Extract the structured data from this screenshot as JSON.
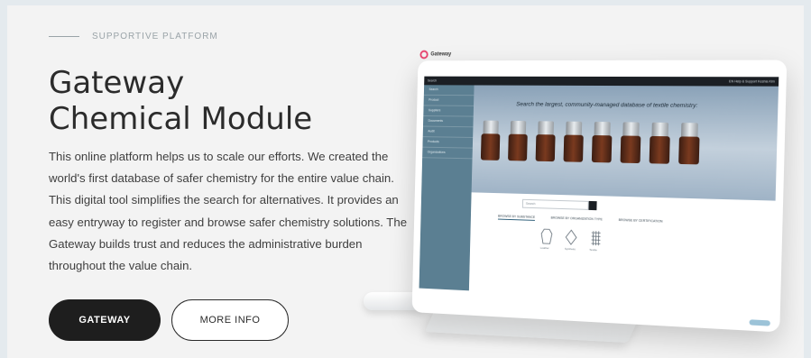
{
  "section": {
    "eyebrow": "SUPPORTIVE PLATFORM",
    "title_line1": "Gateway",
    "title_line2": "Chemical Module",
    "description": "This online platform helps us to scale our efforts. We created the world's first database of safer chemistry for the entire value chain. This digital tool simplifies the search for alternatives. It provides an easy entryway to register and browse safer chemistry solutions. The Gateway builds trust and reduces the administrative burden throughout the value chain.",
    "buttons": {
      "primary_label": "GATEWAY",
      "secondary_label": "MORE INFO"
    }
  },
  "mockup": {
    "logo_text": "Gateway",
    "topbar_left": "Search",
    "topbar_right": "EN  Help & Support  Keshia Kim",
    "sidebar_items": [
      "Search",
      "Product",
      "Suppliers",
      "Documents",
      "Audit",
      "Products",
      "Organizations"
    ],
    "hero_title": "Search the largest, community-managed database of textile chemistry:",
    "search_placeholder": "Search",
    "tabs": [
      "BROWSE BY SUBSTANCE",
      "BROWSE BY ORGANIZATION TYPE",
      "BROWSE BY CERTIFICATION"
    ],
    "icons": [
      {
        "name": "leather-icon",
        "label": "Leather"
      },
      {
        "name": "synthetic-icon",
        "label": "Synthetic"
      },
      {
        "name": "textile-icon",
        "label": "Textile"
      }
    ]
  },
  "colors": {
    "page_background": "#f3f3f3",
    "text_dark": "#2b2b2b",
    "eyebrow_grey": "#9aa3a8",
    "primary_button": "#1e1e1e",
    "sidebar": "#5b7f92"
  }
}
